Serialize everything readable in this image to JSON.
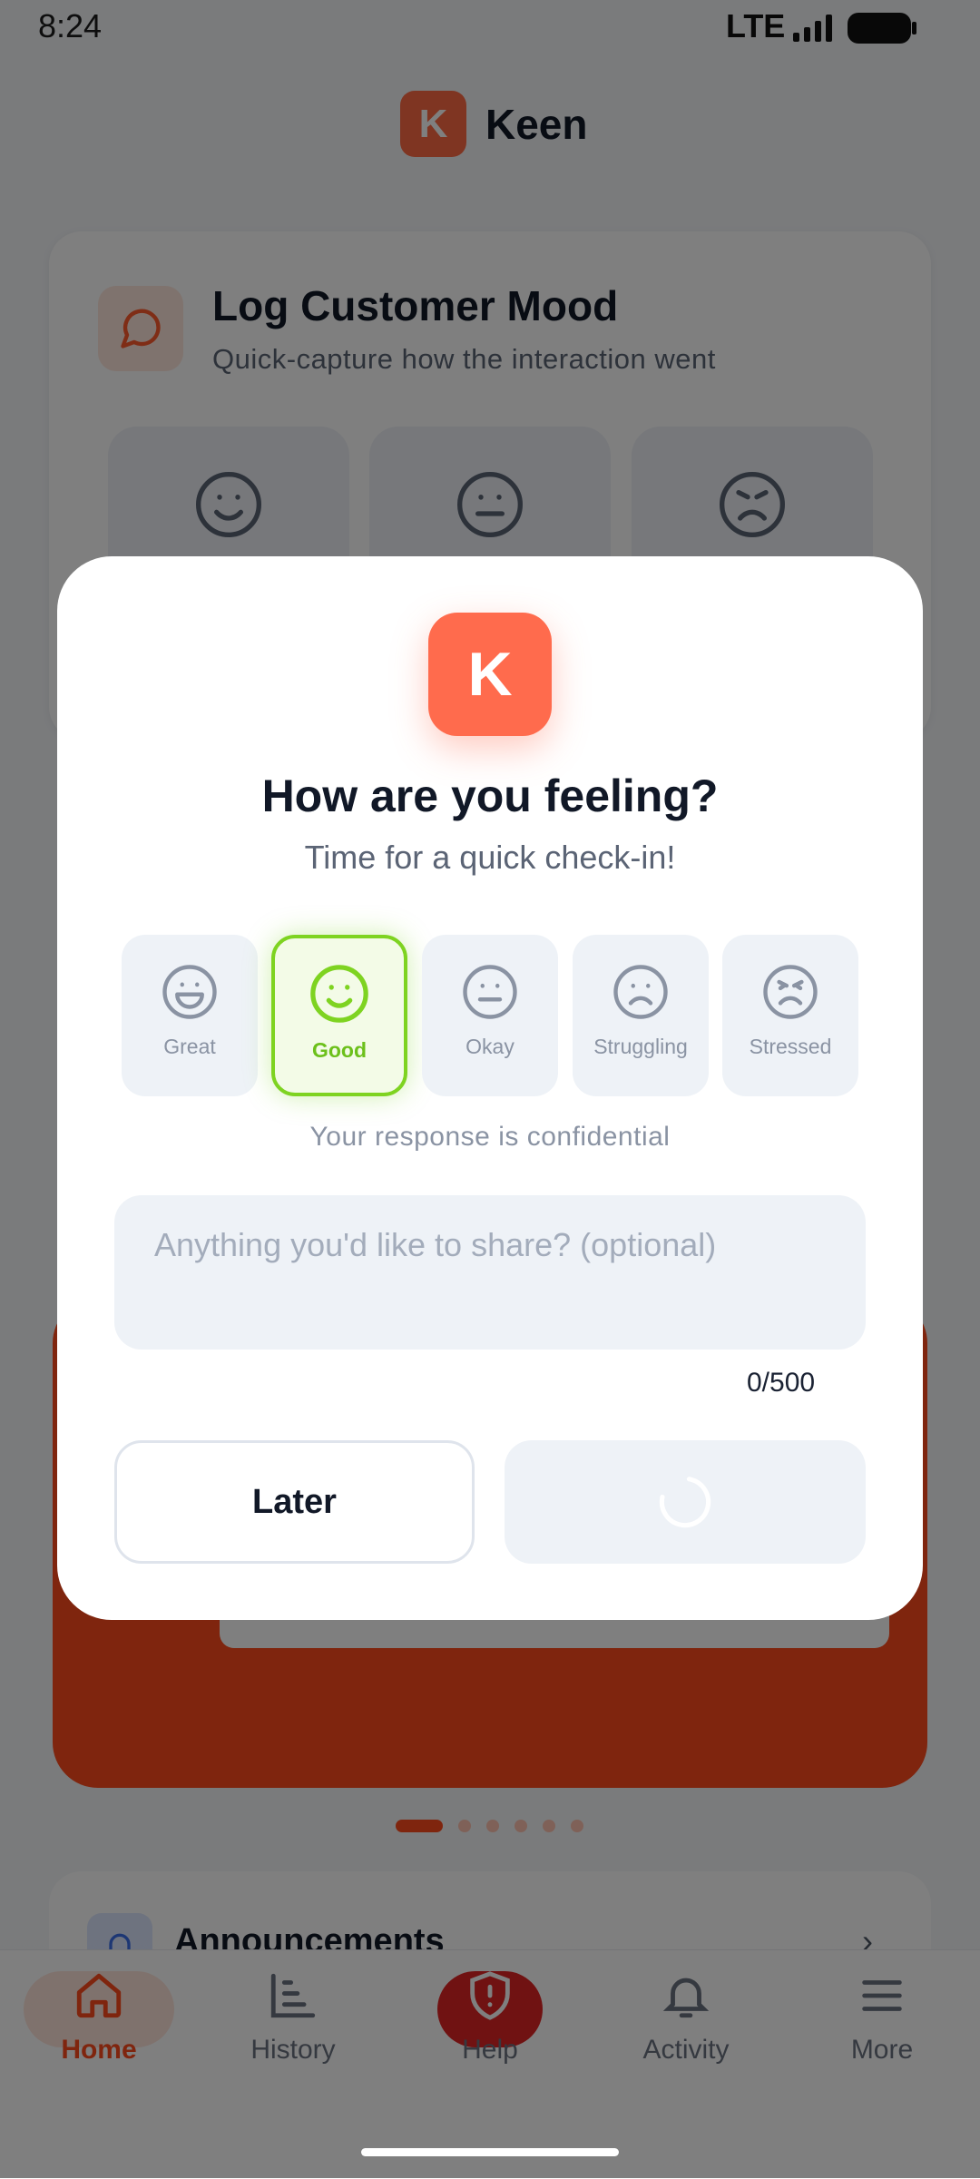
{
  "status_bar": {
    "time": "8:24",
    "network": "LTE"
  },
  "header": {
    "logo_letter": "K",
    "title": "Keen"
  },
  "card": {
    "title": "Log Customer Mood",
    "subtitle": "Quick-capture how the interaction went",
    "tiles": [
      {
        "icon": "smile-icon"
      },
      {
        "icon": "neutral-icon"
      },
      {
        "icon": "angry-icon"
      }
    ]
  },
  "announcements": {
    "title": "Announcements"
  },
  "carousel": {
    "count": 6,
    "active": 0
  },
  "nav": {
    "items": [
      {
        "label": "Home",
        "icon": "home-icon",
        "active": true
      },
      {
        "label": "History",
        "icon": "chart-icon"
      },
      {
        "label": "Help",
        "icon": "shield-icon"
      },
      {
        "label": "Activity",
        "icon": "bell-icon"
      },
      {
        "label": "More",
        "icon": "menu-icon"
      }
    ]
  },
  "modal": {
    "logo_letter": "K",
    "title": "How are you feeling?",
    "subtitle": "Time for a quick check-in!",
    "moods": [
      {
        "label": "Great",
        "icon": "grin-icon",
        "selected": false
      },
      {
        "label": "Good",
        "icon": "smile-icon",
        "selected": true
      },
      {
        "label": "Okay",
        "icon": "neutral-icon",
        "selected": false
      },
      {
        "label": "Struggling",
        "icon": "frown-icon",
        "selected": false
      },
      {
        "label": "Stressed",
        "icon": "stressed-icon",
        "selected": false
      }
    ],
    "confidential_note": "Your response is confidential",
    "note_placeholder": "Anything you'd like to share? (optional)",
    "note_value": "",
    "counter": "0/500",
    "later_label": "Later",
    "submit_state": "loading"
  },
  "colors": {
    "brand": "#ff6b45",
    "hero": "#ff4a1c",
    "selected": "#7ed321",
    "help": "#e02424"
  }
}
